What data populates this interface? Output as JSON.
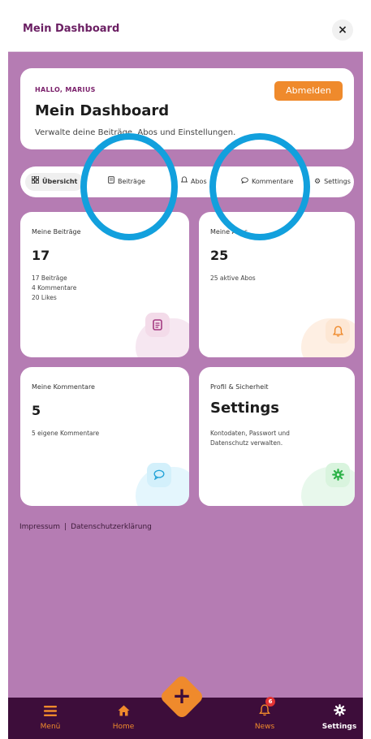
{
  "topbar": {
    "title": "Mein Dashboard",
    "close_icon": "×"
  },
  "hero": {
    "greeting": "HALLO, MARIUS",
    "title": "Mein Dashboard",
    "subtitle": "Verwalte deine Beiträge, Abos und Einstellungen.",
    "logout_label": "Abmelden"
  },
  "tabs": [
    {
      "label": "Übersicht",
      "icon": "grid-icon"
    },
    {
      "label": "Beiträge",
      "icon": "document-icon"
    },
    {
      "label": "Abos",
      "icon": "bell-icon"
    },
    {
      "label": "Kommentare",
      "icon": "comment-icon"
    },
    {
      "label": "Settings",
      "icon": "gear-icon"
    }
  ],
  "cards": [
    {
      "label": "Meine Beiträge",
      "value": "17",
      "details": [
        "17 Beiträge",
        "4 Kommentare",
        "20 Likes"
      ],
      "icon": "document-icon",
      "accent": "#c5679f"
    },
    {
      "label": "Meine Abos",
      "value": "25",
      "details": [
        "25 aktive Abos"
      ],
      "icon": "bell-icon",
      "accent": "#ef8a2c"
    },
    {
      "label": "Meine Kommentare",
      "value": "5",
      "details": [
        "5 eigene Kommentare"
      ],
      "icon": "comment-icon",
      "accent": "#26a4d8"
    },
    {
      "label": "Profil & Sicherheit",
      "value": "Settings",
      "details": [
        "Kontodaten, Passwort und",
        "Datenschutz verwalten."
      ],
      "icon": "gear-icon",
      "accent": "#2fb34a"
    }
  ],
  "footer": {
    "impressum": "Impressum",
    "separator": "|",
    "datenschutz": "Datenschutzerklärung"
  },
  "bottom_nav": [
    {
      "label": "Menü",
      "icon": "menu-icon"
    },
    {
      "label": "Home",
      "icon": "home-icon"
    },
    {
      "label": "News",
      "icon": "bell-icon",
      "badge": "6"
    },
    {
      "label": "Settings",
      "icon": "gear-icon"
    }
  ],
  "fab": {
    "icon": "plus-icon",
    "symbol": "+"
  },
  "colors": {
    "brand": "#6b1f63",
    "background": "#b57cb3",
    "accent_orange": "#ef8a2c",
    "nav_background": "#3d0d3a",
    "annotation_ring": "#12a0dd"
  }
}
